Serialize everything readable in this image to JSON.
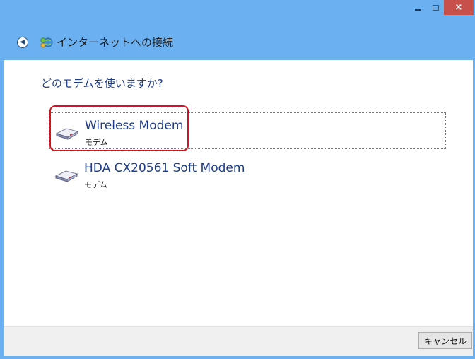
{
  "window": {
    "controls": {
      "minimize_icon": "minimize-icon",
      "maximize_icon": "maximize-icon",
      "close_label": "×"
    },
    "colors": {
      "frame": "#6bb0f0",
      "close_button": "#c7504b",
      "accent_text": "#1e3c8a",
      "highlight": "#d5141d"
    }
  },
  "nav": {
    "back_icon": "back-arrow-icon",
    "app_icon": "network-connection-icon",
    "title": "インターネットへの接続"
  },
  "main": {
    "question": "どのモデムを使いますか?",
    "modems": [
      {
        "name": "Wireless Modem",
        "type": "モデム",
        "icon": "modem-icon",
        "selected": true
      },
      {
        "name": "HDA CX20561 Soft Modem",
        "type": "モデム",
        "icon": "modem-icon",
        "selected": false
      }
    ]
  },
  "footer": {
    "cancel_label": "キャンセル"
  }
}
